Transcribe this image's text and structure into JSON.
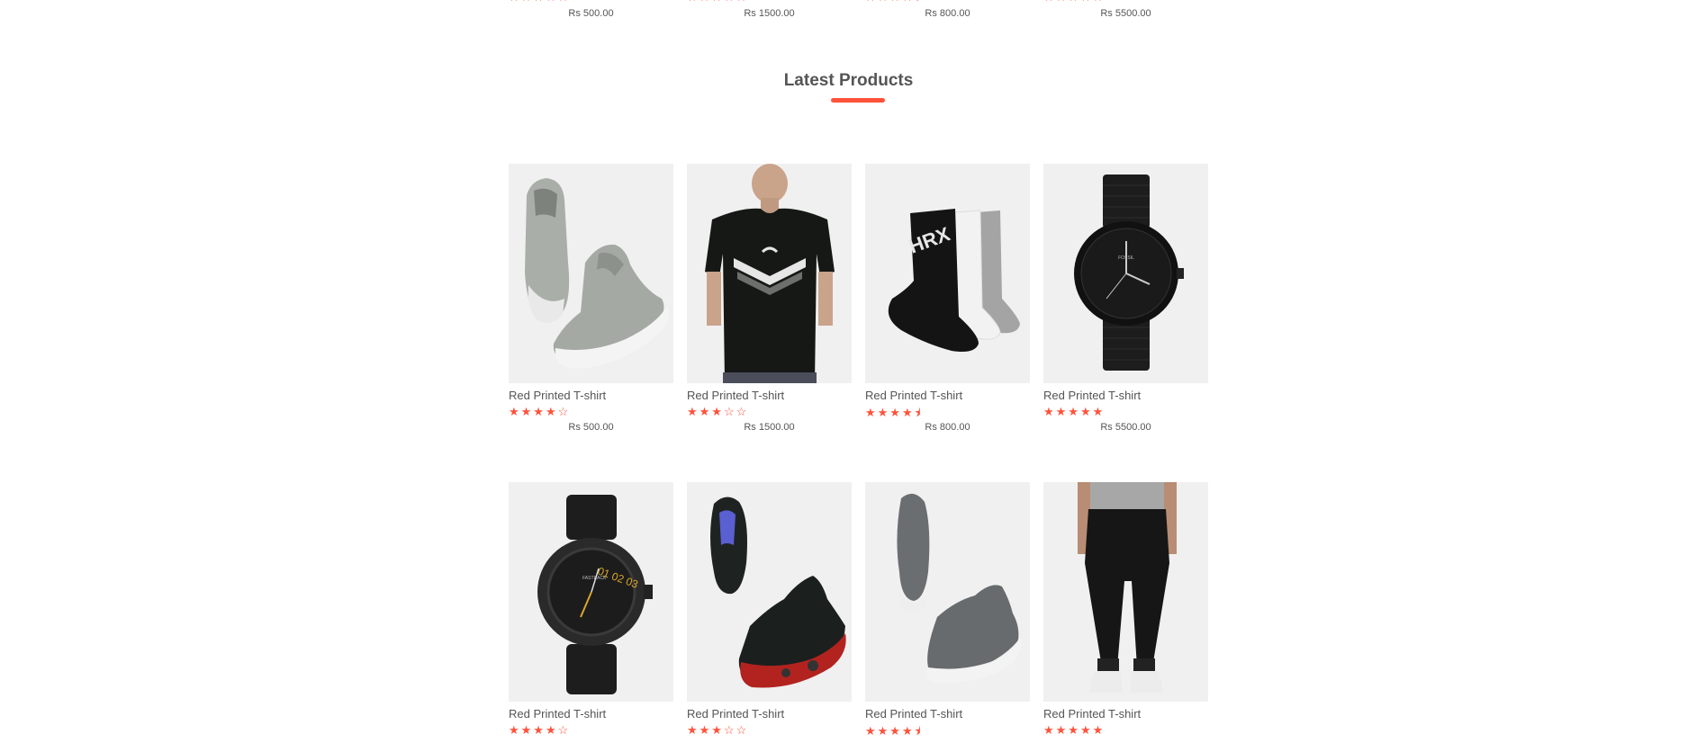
{
  "accent_color": "#ff523b",
  "section": {
    "title": "Latest Products"
  },
  "previous_row": [
    {
      "rating": "★★★★☆",
      "price": "Rs 500.00"
    },
    {
      "rating": "★★★☆☆",
      "price": "Rs 1500.00"
    },
    {
      "rating": "★★★★⯨",
      "price": "Rs 800.00"
    },
    {
      "rating": "★★★★★",
      "price": "Rs 5500.00"
    }
  ],
  "products": [
    {
      "image": "grey-sneakers",
      "name": "Red Printed T-shirt",
      "rating": "★★★★☆",
      "rating_value": 4,
      "price": "Rs 500.00"
    },
    {
      "image": "black-tshirt",
      "name": "Red Printed T-shirt",
      "rating": "★★★☆☆",
      "rating_value": 3,
      "price": "Rs 1500.00"
    },
    {
      "image": "socks",
      "name": "Red Printed T-shirt",
      "rating": "★★★★⯨",
      "rating_value": 4.5,
      "price": "Rs 800.00"
    },
    {
      "image": "black-watch",
      "name": "Red Printed T-shirt",
      "rating": "★★★★★",
      "rating_value": 5,
      "price": "Rs 5500.00"
    },
    {
      "image": "leather-watch",
      "name": "Red Printed T-shirt",
      "rating": "★★★★☆",
      "rating_value": 4
    },
    {
      "image": "running-shoes",
      "name": "Red Printed T-shirt",
      "rating": "★★★☆☆",
      "rating_value": 3
    },
    {
      "image": "slip-on-shoes",
      "name": "Red Printed T-shirt",
      "rating": "★★★★⯨",
      "rating_value": 4.5
    },
    {
      "image": "black-joggers",
      "name": "Red Printed T-shirt",
      "rating": "★★★★★",
      "rating_value": 5
    }
  ]
}
